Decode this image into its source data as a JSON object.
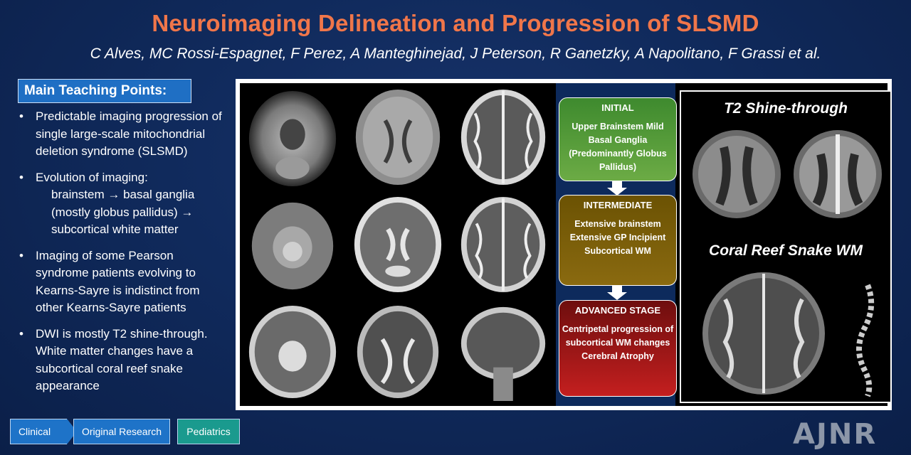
{
  "title": "Neuroimaging Delineation and Progression of SLSMD",
  "authors": "C Alves, MC Rossi-Espagnet,  F Perez, A Manteghinejad,  J Peterson,  R Ganetzky, A Napolitano,  F Grassi et al.",
  "teaching": {
    "heading": "Main Teaching Points:",
    "points": [
      "Predictable imaging progression of single large-scale mitochondrial deletion syndrome (SLSMD)",
      "Evolution of imaging:",
      "Imaging of some Pearson syndrome patients evolving to Kearns-Sayre is indistinct from other Kearns-Sayre patients",
      "DWI is mostly T2 shine-through. White matter changes have a subcortical coral reef snake appearance"
    ],
    "evolution_sub": "brainstem → basal ganglia (mostly globus pallidus) → subcortical white matter"
  },
  "stages": [
    {
      "heading": "INITIAL",
      "body": "Upper Brainstem Mild Basal Ganglia (Predominantly Globus Pallidus)",
      "color": "#5a9e3a"
    },
    {
      "heading": "INTERMEDIATE",
      "body": "Extensive brainstem Extensive GP Incipient Subcortical WM",
      "color": "#7d5f0a"
    },
    {
      "heading": "ADVANCED STAGE",
      "body": "Centripetal progression of subcortical WM changes Cerebral Atrophy",
      "color": "#b01a1a"
    }
  ],
  "right_box": {
    "title1": "T2 Shine-through",
    "title2": "Coral Reef Snake WM"
  },
  "tags": [
    "Clinical",
    "Original Research",
    "Pediatrics"
  ],
  "logo": "AJNR",
  "colors": {
    "title": "#f0764a",
    "background": "#102a5c",
    "tag_blue": "#1e73c8",
    "tag_teal": "#1a9a8e"
  }
}
